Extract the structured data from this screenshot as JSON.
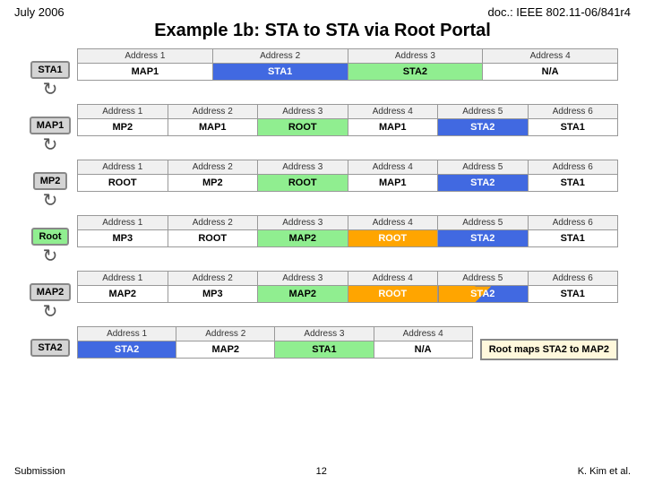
{
  "header": {
    "left": "July 2006",
    "right": "doc.: IEEE 802.11-06/841r4"
  },
  "title": "Example 1b: STA to STA via Root Portal",
  "rows": [
    {
      "label": "STA1",
      "headers": [
        "Address 1",
        "Address 2",
        "Address 3",
        "Address 4"
      ],
      "cells": [
        {
          "text": "MAP1",
          "style": "white"
        },
        {
          "text": "STA1",
          "style": "blue"
        },
        {
          "text": "STA2",
          "style": "green"
        },
        {
          "text": "N/A",
          "style": "white"
        }
      ],
      "note": null
    },
    {
      "label": "MAP1",
      "headers": [
        "Address 1",
        "Address 2",
        "Address 3",
        "Address 4",
        "Address 5",
        "Address 6"
      ],
      "cells": [
        {
          "text": "MP2",
          "style": "white"
        },
        {
          "text": "MAP1",
          "style": "white"
        },
        {
          "text": "ROOT",
          "style": "green"
        },
        {
          "text": "MAP1",
          "style": "white"
        },
        {
          "text": "STA2",
          "style": "blue"
        },
        {
          "text": "STA1",
          "style": "white"
        }
      ],
      "note": null
    },
    {
      "label": "MP2",
      "headers": [
        "Address 1",
        "Address 2",
        "Address 3",
        "Address 4",
        "Address 5",
        "Address 6"
      ],
      "cells": [
        {
          "text": "ROOT",
          "style": "white"
        },
        {
          "text": "MP2",
          "style": "white"
        },
        {
          "text": "ROOT",
          "style": "green"
        },
        {
          "text": "MAP1",
          "style": "white"
        },
        {
          "text": "STA2",
          "style": "blue"
        },
        {
          "text": "STA1",
          "style": "white"
        }
      ],
      "note": null
    },
    {
      "label": "Root",
      "labelGreen": true,
      "headers": [
        "Address 1",
        "Address 2",
        "Address 3",
        "Address 4",
        "Address 5",
        "Address 6"
      ],
      "cells": [
        {
          "text": "MP3",
          "style": "white"
        },
        {
          "text": "ROOT",
          "style": "white"
        },
        {
          "text": "MAP2",
          "style": "green"
        },
        {
          "text": "ROOT",
          "style": "orange"
        },
        {
          "text": "STA2",
          "style": "blue"
        },
        {
          "text": "STA1",
          "style": "white"
        }
      ],
      "note": null
    },
    {
      "label": "MAP2",
      "headers": [
        "Address 1",
        "Address 2",
        "Address 3",
        "Address 4",
        "Address 5",
        "Address 6"
      ],
      "cells": [
        {
          "text": "MAP2",
          "style": "white"
        },
        {
          "text": "MP3",
          "style": "white"
        },
        {
          "text": "MAP2",
          "style": "green"
        },
        {
          "text": "ROOT",
          "style": "orange"
        },
        {
          "text": "STA2",
          "style": "diagonal"
        },
        {
          "text": "STA1",
          "style": "white"
        }
      ],
      "note": null
    },
    {
      "label": "STA2",
      "headers": [
        "Address 1",
        "Address 2",
        "Address 3",
        "Address 4"
      ],
      "cells": [
        {
          "text": "STA2",
          "style": "blue"
        },
        {
          "text": "MAP2",
          "style": "white"
        },
        {
          "text": "STA1",
          "style": "green"
        },
        {
          "text": "N/A",
          "style": "white"
        }
      ],
      "note": "Root maps STA2 to MAP2"
    }
  ],
  "footer": {
    "left": "Submission",
    "center": "12",
    "right": "K. Kim et al."
  }
}
